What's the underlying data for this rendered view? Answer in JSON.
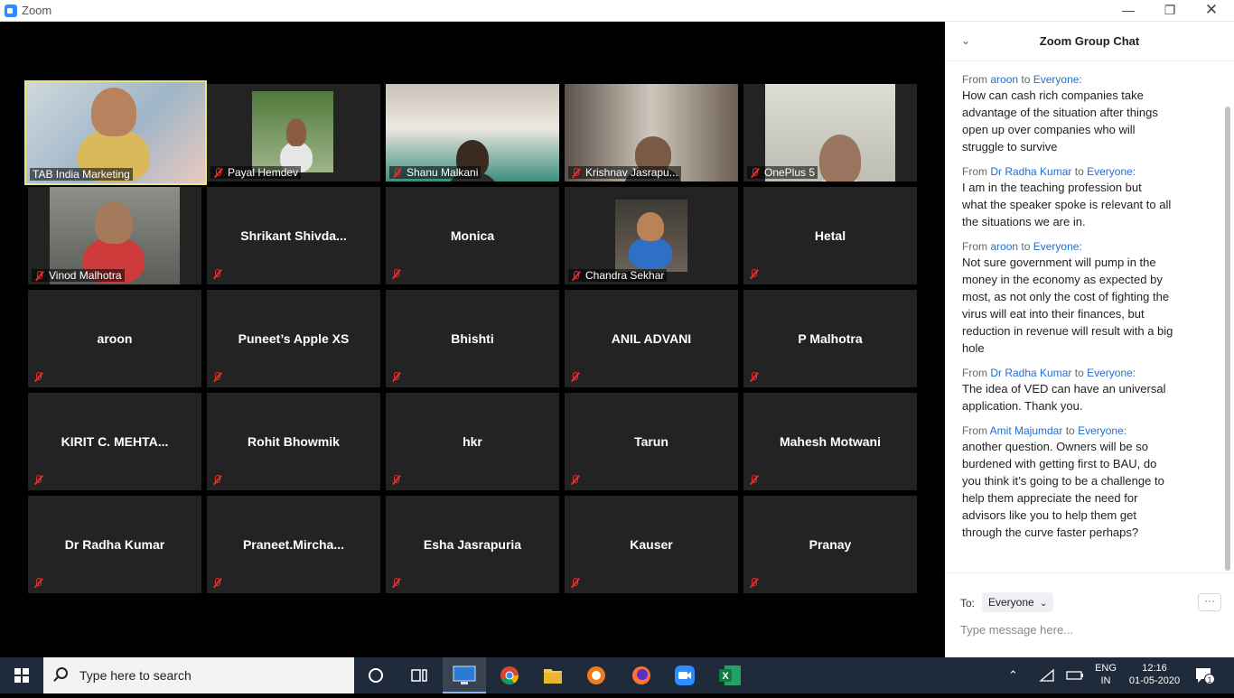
{
  "window": {
    "title": "Zoom"
  },
  "gallery": [
    [
      {
        "name": "TAB India Marketing",
        "video": true,
        "active": true,
        "muted": false
      },
      {
        "name": "Payal Hemdev",
        "video": true,
        "muted": true
      },
      {
        "name": "Shanu Malkani",
        "video": true,
        "muted": true
      },
      {
        "name": "Krishnav Jasrapu...",
        "video": true,
        "muted": true
      },
      {
        "name": "OnePlus 5",
        "video": true,
        "muted": true
      }
    ],
    [
      {
        "name": "Vinod Malhotra",
        "video": true,
        "muted": true
      },
      {
        "name": "Shrikant  Shivda...",
        "video": false,
        "muted": true
      },
      {
        "name": "Monica",
        "video": false,
        "muted": true
      },
      {
        "name": "Chandra Sekhar",
        "video": true,
        "muted": true
      },
      {
        "name": "Hetal",
        "video": false,
        "muted": true
      }
    ],
    [
      {
        "name": "aroon",
        "video": false,
        "muted": true
      },
      {
        "name": "Puneet’s Apple XS",
        "video": false,
        "muted": true
      },
      {
        "name": "Bhishti",
        "video": false,
        "muted": true
      },
      {
        "name": "ANIL ADVANI",
        "video": false,
        "muted": true
      },
      {
        "name": "P Malhotra",
        "video": false,
        "muted": true
      }
    ],
    [
      {
        "name": "KIRIT C. MEHTA...",
        "video": false,
        "muted": true
      },
      {
        "name": "Rohit Bhowmik",
        "video": false,
        "muted": true
      },
      {
        "name": "hkr",
        "video": false,
        "muted": true
      },
      {
        "name": "Tarun",
        "video": false,
        "muted": true
      },
      {
        "name": "Mahesh Motwani",
        "video": false,
        "muted": true
      }
    ],
    [
      {
        "name": "Dr Radha Kumar",
        "video": false,
        "muted": true
      },
      {
        "name": "Praneet.Mircha...",
        "video": false,
        "muted": true
      },
      {
        "name": "Esha Jasrapuria",
        "video": false,
        "muted": true
      },
      {
        "name": "Kauser",
        "video": false,
        "muted": true
      },
      {
        "name": "Pranay",
        "video": false,
        "muted": true
      }
    ]
  ],
  "chat": {
    "title": "Zoom Group Chat",
    "messages": [
      {
        "from_word": "From",
        "sender": "aroon",
        "to_word": "to",
        "recipient": "Everyone:",
        "lines": [
          "How can cash rich companies take",
          "advantage of the situation after things",
          "open up over companies who will",
          "struggle to survive"
        ]
      },
      {
        "from_word": "From",
        "sender": "Dr Radha Kumar",
        "to_word": "to",
        "recipient": "Everyone:",
        "lines": [
          "I am in the teaching  profession  but",
          "what the  speaker spoke is relevant to all",
          "the situations  we are  in."
        ]
      },
      {
        "from_word": "From",
        "sender": "aroon",
        "to_word": "to",
        "recipient": "Everyone:",
        "lines": [
          "Not sure government will pump in the",
          "money in the economy as expected by",
          "most, as not only the cost of fighting the",
          "virus will eat into their finances, but",
          "reduction in revenue will result with a big",
          "hole"
        ]
      },
      {
        "from_word": "From",
        "sender": "Dr Radha Kumar",
        "to_word": "to",
        "recipient": "Everyone:",
        "lines": [
          "The idea of VED can have an universal",
          "application. Thank  you."
        ]
      },
      {
        "from_word": "From",
        "sender": "Amit Majumdar",
        "to_word": "to",
        "recipient": "Everyone:",
        "lines": [
          "another question. Owners will be so",
          "burdened with getting first to BAU, do",
          "you think it’s going to be a challenge to",
          "help them appreciate the need for",
          "advisors like you to help them get",
          "through the curve faster perhaps?"
        ]
      }
    ],
    "to_label": "To:",
    "to_value": "Everyone",
    "more_label": "···",
    "input_placeholder": "Type message here..."
  },
  "taskbar": {
    "search_placeholder": "Type here to search",
    "lang_top": "ENG",
    "lang_bottom": "IN",
    "time": "12:16",
    "date": "01-05-2020",
    "notification_count": "1"
  },
  "colors": {
    "accent": "#2d8cff",
    "mute_red": "#e0312c",
    "active_border": "#e8e87a",
    "tile_bg": "#232323"
  }
}
